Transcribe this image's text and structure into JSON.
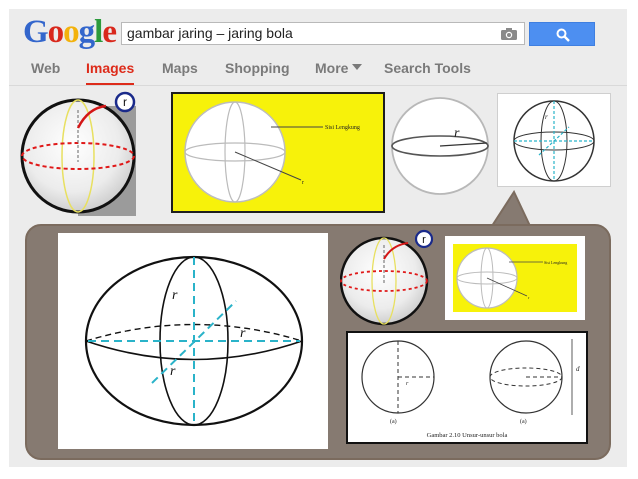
{
  "search": {
    "query": "gambar jaring – jaring bola"
  },
  "logo": {
    "letters": [
      "G",
      "o",
      "o",
      "g",
      "l",
      "e"
    ],
    "colors": [
      "#3366cc",
      "#d9281c",
      "#f3b20c",
      "#3366cc",
      "#2c9a3c",
      "#d9281c"
    ]
  },
  "nav": {
    "web": "Web",
    "images": "Images",
    "maps": "Maps",
    "shopping": "Shopping",
    "more": "More",
    "search_tools": "Search Tools"
  },
  "figures": {
    "r": "r",
    "sisi_lengkung": "Sisi Lengkung",
    "caption": "Gambar 2.10 Unsur-unsur bola",
    "label_a": "(a)",
    "label_d": "d"
  },
  "colors": {
    "accent_red": "#dd2b1a",
    "search_blue": "#4d8ff1",
    "yellow": "#f7f20a",
    "popup_bg": "#867a71"
  }
}
